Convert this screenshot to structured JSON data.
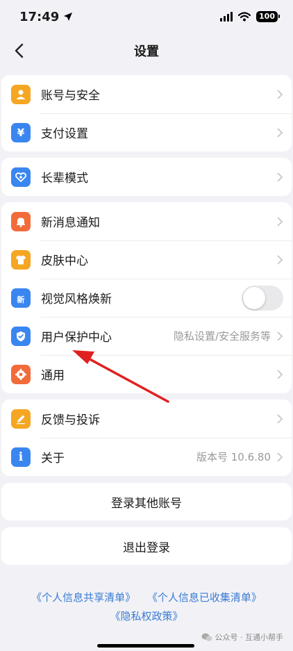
{
  "status": {
    "time": "17:49",
    "battery": "100"
  },
  "nav": {
    "title": "设置"
  },
  "groups": [
    {
      "items": [
        {
          "label": "账号与安全",
          "icon": "person-icon",
          "color": "#f5a623"
        },
        {
          "label": "支付设置",
          "icon": "yen-icon",
          "color": "#3a86f0"
        }
      ]
    },
    {
      "items": [
        {
          "label": "长辈模式",
          "icon": "elder-heart-icon",
          "color": "#3a86f0"
        }
      ]
    },
    {
      "items": [
        {
          "label": "新消息通知",
          "icon": "bell-icon",
          "color": "#f26b3a"
        },
        {
          "label": "皮肤中心",
          "icon": "shirt-icon",
          "color": "#f5a623"
        },
        {
          "label": "视觉风格焕新",
          "icon": "new-style-icon",
          "color": "#3a86f0",
          "toggle": false,
          "badge": "新"
        },
        {
          "label": "用户保护中心",
          "icon": "shield-icon",
          "color": "#3a86f0",
          "value": "隐私设置/安全服务等"
        },
        {
          "label": "通用",
          "icon": "gear-icon",
          "color": "#f26b3a"
        }
      ]
    },
    {
      "items": [
        {
          "label": "反馈与投诉",
          "icon": "pencil-icon",
          "color": "#f5a623"
        },
        {
          "label": "关于",
          "icon": "info-icon",
          "color": "#3a86f0",
          "value": "版本号 10.6.80"
        }
      ]
    }
  ],
  "buttons": {
    "switch_account": "登录其他账号",
    "logout": "退出登录"
  },
  "links": {
    "shared_list": "《个人信息共享清单》",
    "collected_list": "《个人信息已收集清单》",
    "privacy_policy": "《隐私权政策》"
  },
  "watermark": {
    "text": "公众号 · 互通小帮手"
  },
  "colors": {
    "accent_link": "#3a7bd5",
    "annotation_arrow": "#e02020"
  }
}
